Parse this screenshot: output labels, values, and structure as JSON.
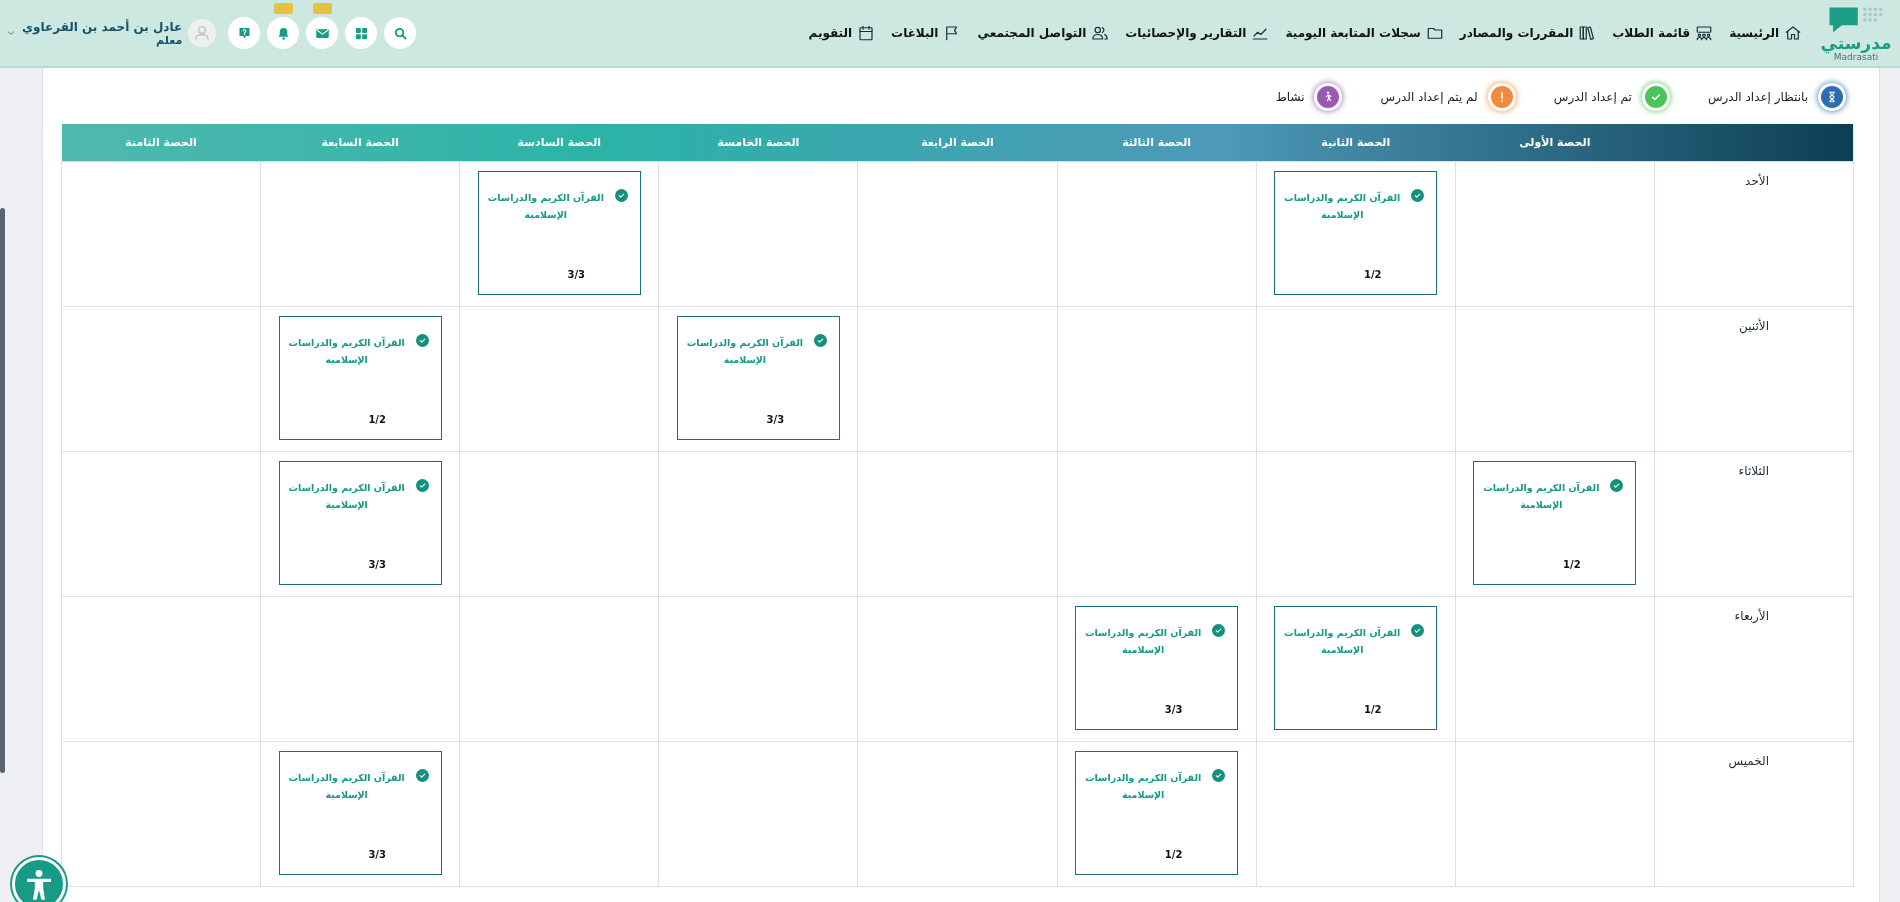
{
  "header": {
    "logo": {
      "text": "مدرستي",
      "subtext": "Madrasati"
    },
    "nav": [
      {
        "label": "الرئيسية"
      },
      {
        "label": "قائمة الطلاب"
      },
      {
        "label": "المقررات والمصادر"
      },
      {
        "label": "سجلات المتابعة اليومية"
      },
      {
        "label": "التقارير والإحصائيات"
      },
      {
        "label": "التواصل المجتمعي"
      },
      {
        "label": "البلاغات"
      },
      {
        "label": "التقويم"
      }
    ],
    "icon_buttons": [
      {
        "badge": false
      },
      {
        "badge": false
      },
      {
        "badge": true
      },
      {
        "badge": true
      },
      {
        "badge": false
      }
    ],
    "user": {
      "name": "عادل بن أحمد بن القرعاوي",
      "role": "معلم"
    }
  },
  "legend": [
    {
      "kind": "pending",
      "label": "بانتظار إعداد الدرس",
      "color": "#2f6db3"
    },
    {
      "kind": "done",
      "label": "تم إعداد الدرس",
      "color": "#4cc35a"
    },
    {
      "kind": "missing",
      "label": "لم يتم إعداد الدرس",
      "color": "#f08a3c"
    },
    {
      "kind": "activity",
      "label": "نشاط",
      "color": "#9b59b6"
    }
  ],
  "schedule": {
    "columns": [
      "الحصة الأولى",
      "الحصة الثانية",
      "الحصة الثالثة",
      "الحصة الرابعة",
      "الحصة الخامسة",
      "الحصة السادسة",
      "الحصة السابعة",
      "الحصة الثامنة"
    ],
    "rows": [
      {
        "day": "الأحد",
        "cells": [
          {
            "kind": "empty"
          },
          {
            "kind": "lesson",
            "subject": "القرآن الكريم والدراسات الإسلامية",
            "count": "1/2"
          },
          {
            "kind": "empty"
          },
          {
            "kind": "empty"
          },
          {
            "kind": "empty"
          },
          {
            "kind": "lesson",
            "subject": "القرآن الكريم والدراسات الإسلامية",
            "count": "3/3"
          },
          {
            "kind": "empty"
          },
          {
            "kind": "empty"
          }
        ]
      },
      {
        "day": "الأثنين",
        "cells": [
          {
            "kind": "empty"
          },
          {
            "kind": "empty"
          },
          {
            "kind": "empty"
          },
          {
            "kind": "empty"
          },
          {
            "kind": "lesson",
            "subject": "القرآن الكريم والدراسات الإسلامية",
            "count": "3/3"
          },
          {
            "kind": "empty"
          },
          {
            "kind": "lesson",
            "subject": "القرآن الكريم والدراسات الإسلامية",
            "count": "1/2"
          },
          {
            "kind": "empty"
          }
        ]
      },
      {
        "day": "الثلاثاء",
        "cells": [
          {
            "kind": "lesson",
            "subject": "القرآن الكريم والدراسات الإسلامية",
            "count": "1/2"
          },
          {
            "kind": "empty"
          },
          {
            "kind": "empty"
          },
          {
            "kind": "empty"
          },
          {
            "kind": "empty"
          },
          {
            "kind": "empty"
          },
          {
            "kind": "lesson",
            "subject": "القرآن الكريم والدراسات الإسلامية",
            "count": "3/3"
          },
          {
            "kind": "empty"
          }
        ]
      },
      {
        "day": "الأربعاء",
        "cells": [
          {
            "kind": "empty"
          },
          {
            "kind": "lesson",
            "subject": "القرآن الكريم والدراسات الإسلامية",
            "count": "1/2"
          },
          {
            "kind": "lesson",
            "subject": "القرآن الكريم والدراسات الإسلامية",
            "count": "3/3"
          },
          {
            "kind": "empty"
          },
          {
            "kind": "empty"
          },
          {
            "kind": "empty"
          },
          {
            "kind": "empty"
          },
          {
            "kind": "empty"
          }
        ]
      },
      {
        "day": "الخميس",
        "cells": [
          {
            "kind": "empty"
          },
          {
            "kind": "empty"
          },
          {
            "kind": "lesson",
            "subject": "القرآن الكريم والدراسات الإسلامية",
            "count": "1/2"
          },
          {
            "kind": "empty"
          },
          {
            "kind": "empty"
          },
          {
            "kind": "empty"
          },
          {
            "kind": "lesson",
            "subject": "القرآن الكريم والدراسات الإسلامية",
            "count": "3/3"
          },
          {
            "kind": "empty"
          }
        ]
      }
    ]
  }
}
